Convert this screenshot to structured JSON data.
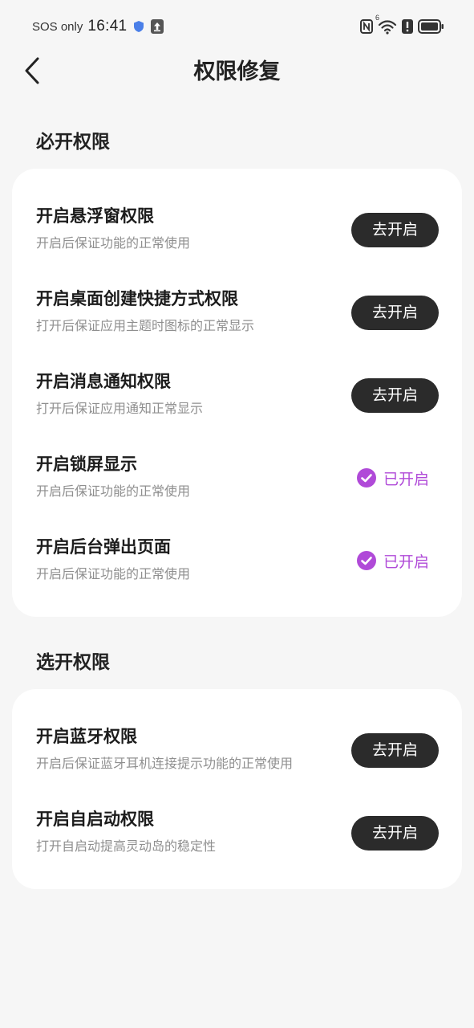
{
  "status_bar": {
    "carrier": "SOS only",
    "time": "16:41",
    "left_icons": [
      "shield-icon",
      "upload-icon"
    ],
    "right_icons": [
      "nfc-icon",
      "wifi-icon",
      "alert-icon",
      "battery-icon"
    ],
    "wifi_badge": "6"
  },
  "header": {
    "back_icon": "chevron-left-icon",
    "title": "权限修复"
  },
  "required": {
    "title": "必开权限",
    "items": [
      {
        "title": "开启悬浮窗权限",
        "desc": "开启后保证功能的正常使用",
        "state": "go",
        "button": "去开启"
      },
      {
        "title": "开启桌面创建快捷方式权限",
        "desc": "打开后保证应用主题时图标的正常显示",
        "state": "go",
        "button": "去开启"
      },
      {
        "title": "开启消息通知权限",
        "desc": "打开后保证应用通知正常显示",
        "state": "go",
        "button": "去开启"
      },
      {
        "title": "开启锁屏显示",
        "desc": "开启后保证功能的正常使用",
        "state": "enabled",
        "status": "已开启"
      },
      {
        "title": "开启后台弹出页面",
        "desc": "开启后保证功能的正常使用",
        "state": "enabled",
        "status": "已开启"
      }
    ]
  },
  "optional": {
    "title": "选开权限",
    "items": [
      {
        "title": "开启蓝牙权限",
        "desc": "开启后保证蓝牙耳机连接提示功能的正常使用",
        "state": "go",
        "button": "去开启"
      },
      {
        "title": "开启自启动权限",
        "desc": "打开自启动提高灵动岛的稳定性",
        "state": "go",
        "button": "去开启"
      }
    ]
  },
  "colors": {
    "background": "#f6f6f6",
    "card": "#ffffff",
    "button": "#2b2b2b",
    "enabled_accent": "#b04ad8"
  }
}
